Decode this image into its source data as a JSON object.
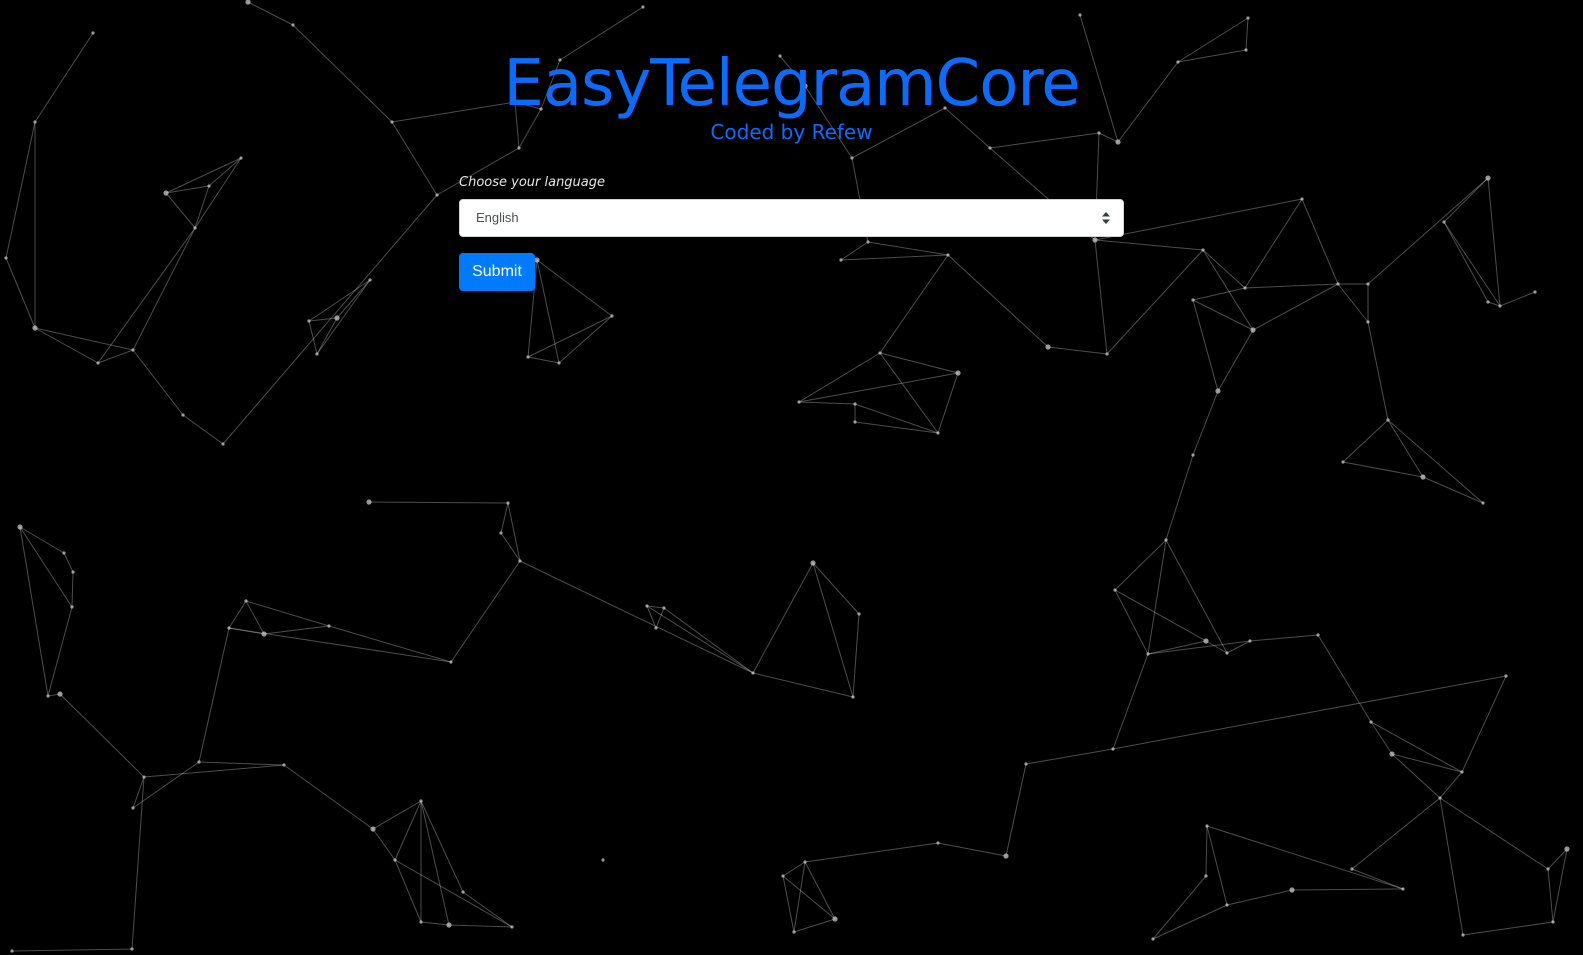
{
  "header": {
    "title": "EasyTelegramCore",
    "subtitle": "Coded by Refew"
  },
  "form": {
    "language_label": "Choose your language",
    "language_select": {
      "selected": "English",
      "arrow_icon": "select-arrows-icon"
    },
    "submit_label": "Submit"
  },
  "colors": {
    "background": "#000000",
    "accent": "#0a6cff",
    "button": "#007bff",
    "network_lines": "#c8c8c8"
  }
}
